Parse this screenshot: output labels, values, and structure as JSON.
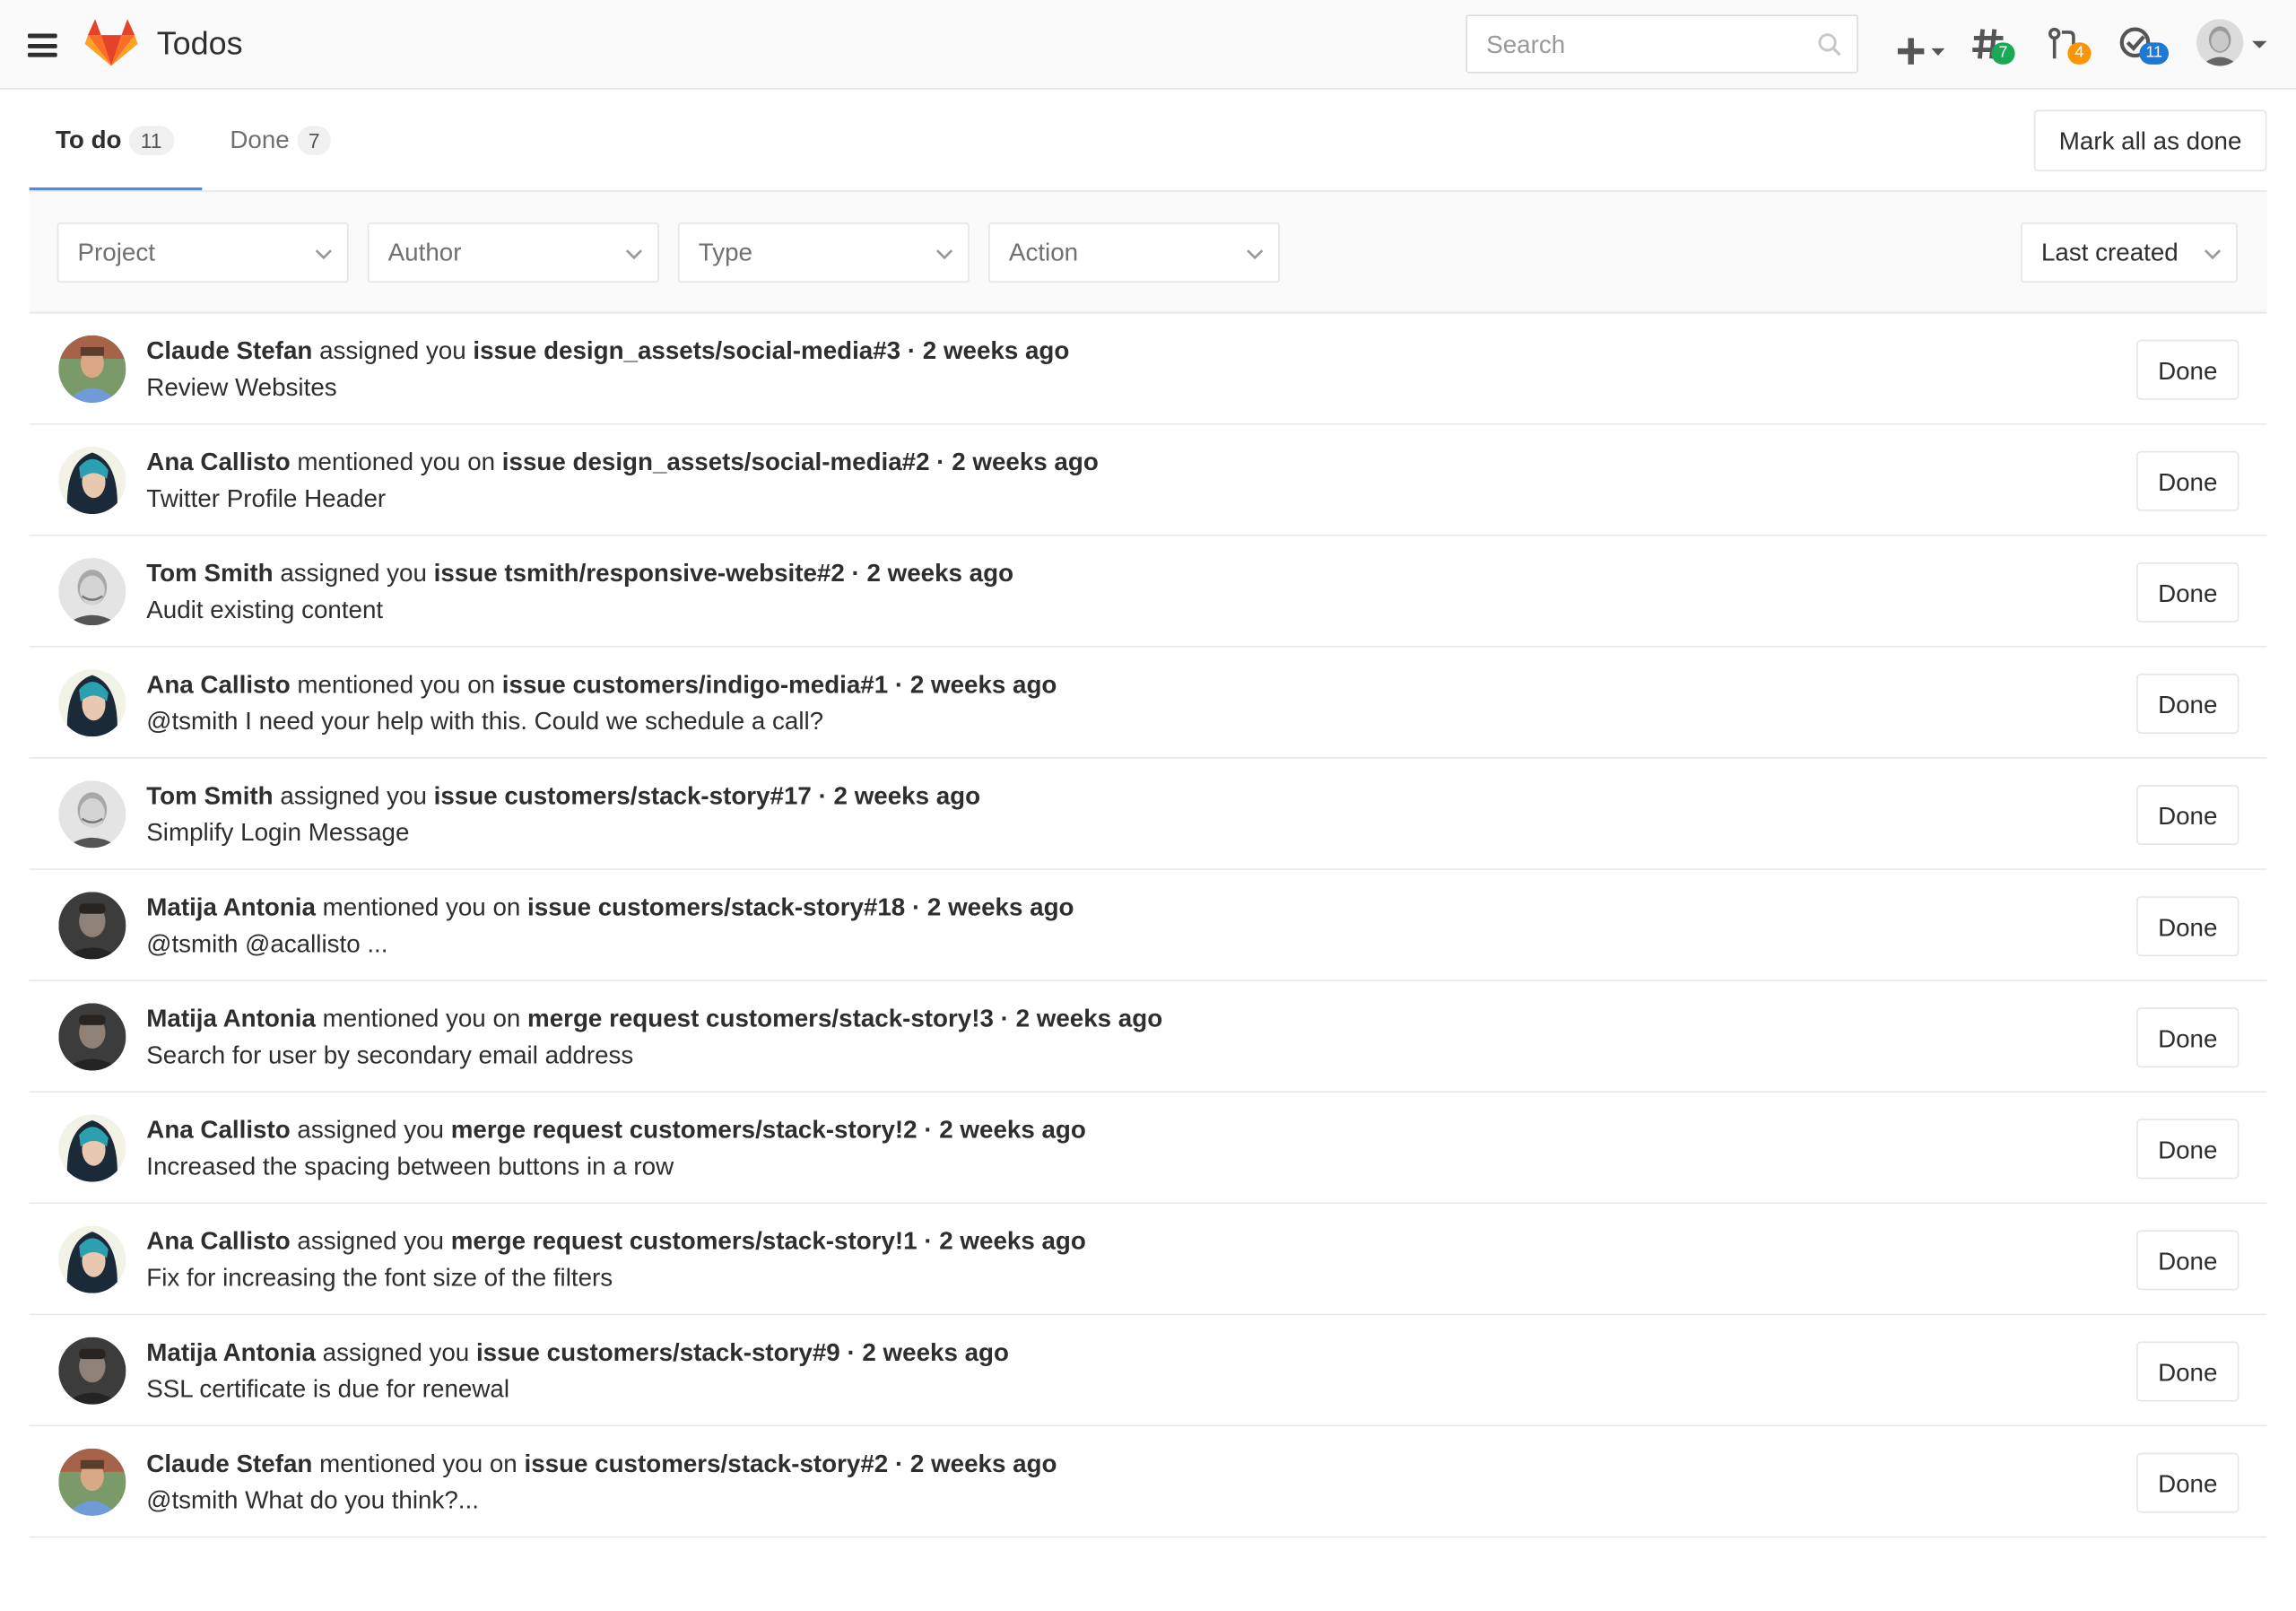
{
  "header": {
    "title": "Todos",
    "search_placeholder": "Search",
    "issues_count": "7",
    "merge_requests_count": "4",
    "todos_count": "11",
    "colors": {
      "issues_badge": "#1aaa55",
      "mr_badge": "#fc9403",
      "todos_badge": "#1f78d1"
    }
  },
  "tabs": [
    {
      "label": "To do",
      "count": "11"
    },
    {
      "label": "Done",
      "count": "7"
    }
  ],
  "mark_all_label": "Mark all as done",
  "filters": {
    "project": "Project",
    "author": "Author",
    "type": "Type",
    "action": "Action",
    "sort": "Last created"
  },
  "done_label": "Done",
  "todos": [
    {
      "author": "Claude Stefan",
      "action": "assigned you",
      "target": "issue design_assets/social-media#3",
      "time": "2 weeks ago",
      "body": "Review Websites",
      "avatar": "claude"
    },
    {
      "author": "Ana Callisto",
      "action": "mentioned you on",
      "target": "issue design_assets/social-media#2",
      "time": "2 weeks ago",
      "body": "Twitter Profile Header",
      "avatar": "ana"
    },
    {
      "author": "Tom Smith",
      "action": "assigned you",
      "target": "issue tsmith/responsive-website#2",
      "time": "2 weeks ago",
      "body": "Audit existing content",
      "avatar": "tom"
    },
    {
      "author": "Ana Callisto",
      "action": "mentioned you on",
      "target": "issue customers/indigo-media#1",
      "time": "2 weeks ago",
      "body": "@tsmith I need your help with this. Could we schedule a call?",
      "avatar": "ana"
    },
    {
      "author": "Tom Smith",
      "action": "assigned you",
      "target": "issue customers/stack-story#17",
      "time": "2 weeks ago",
      "body": "Simplify Login Message",
      "avatar": "tom"
    },
    {
      "author": "Matija Antonia",
      "action": "mentioned you on",
      "target": "issue customers/stack-story#18",
      "time": "2 weeks ago",
      "body": "@tsmith @acallisto ...",
      "avatar": "matija"
    },
    {
      "author": "Matija Antonia",
      "action": "mentioned you on",
      "target": "merge request customers/stack-story!3",
      "time": "2 weeks ago",
      "body": "Search for user by secondary email address",
      "avatar": "matija"
    },
    {
      "author": "Ana Callisto",
      "action": "assigned you",
      "target": "merge request customers/stack-story!2",
      "time": "2 weeks ago",
      "body": "Increased the spacing between buttons in a row",
      "avatar": "ana"
    },
    {
      "author": "Ana Callisto",
      "action": "assigned you",
      "target": "merge request customers/stack-story!1",
      "time": "2 weeks ago",
      "body": "Fix for increasing the font size of the filters",
      "avatar": "ana"
    },
    {
      "author": "Matija Antonia",
      "action": "assigned you",
      "target": "issue customers/stack-story#9",
      "time": "2 weeks ago",
      "body": "SSL certificate is due for renewal",
      "avatar": "matija"
    },
    {
      "author": "Claude Stefan",
      "action": "mentioned you on",
      "target": "issue customers/stack-story#2",
      "time": "2 weeks ago",
      "body": "@tsmith What do you think?...",
      "avatar": "claude"
    }
  ]
}
